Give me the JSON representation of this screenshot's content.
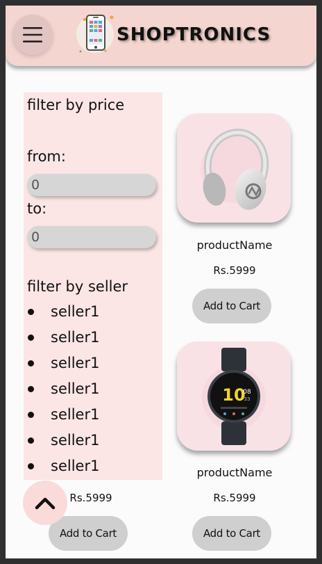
{
  "header": {
    "brand": "SHOPTRONICS",
    "menu_icon": "hamburger-menu-icon",
    "logo_icon": "smartphone-logo-icon"
  },
  "filters": {
    "price_heading": "filter by price",
    "from_label": "from:",
    "from_value": "0",
    "to_label": "to:",
    "to_value": "0",
    "seller_heading": "filter by seller",
    "sellers": [
      "seller1",
      "seller1",
      "seller1",
      "seller1",
      "seller1",
      "seller1",
      "seller1"
    ]
  },
  "products": [
    {
      "name": "productName",
      "price": "Rs.5999",
      "cart_label": "Add to Cart",
      "image": "headphones"
    },
    {
      "name": "productName",
      "price": "Rs.5999",
      "cart_label": "Add to Cart",
      "image": "smartwatch"
    }
  ],
  "partial_product": {
    "price": "Rs.5999",
    "cart_label": "Add to Cart"
  },
  "scroll_top_icon": "chevron-up-icon",
  "colors": {
    "header_bg": "#f5d5cf",
    "filter_bg": "#fbe5e5",
    "card_bg": "#f9e2e6",
    "button_bg": "#cfcfcf",
    "menu_btn_bg": "#e2c4c2",
    "scroll_top_bg": "#fbdada"
  }
}
